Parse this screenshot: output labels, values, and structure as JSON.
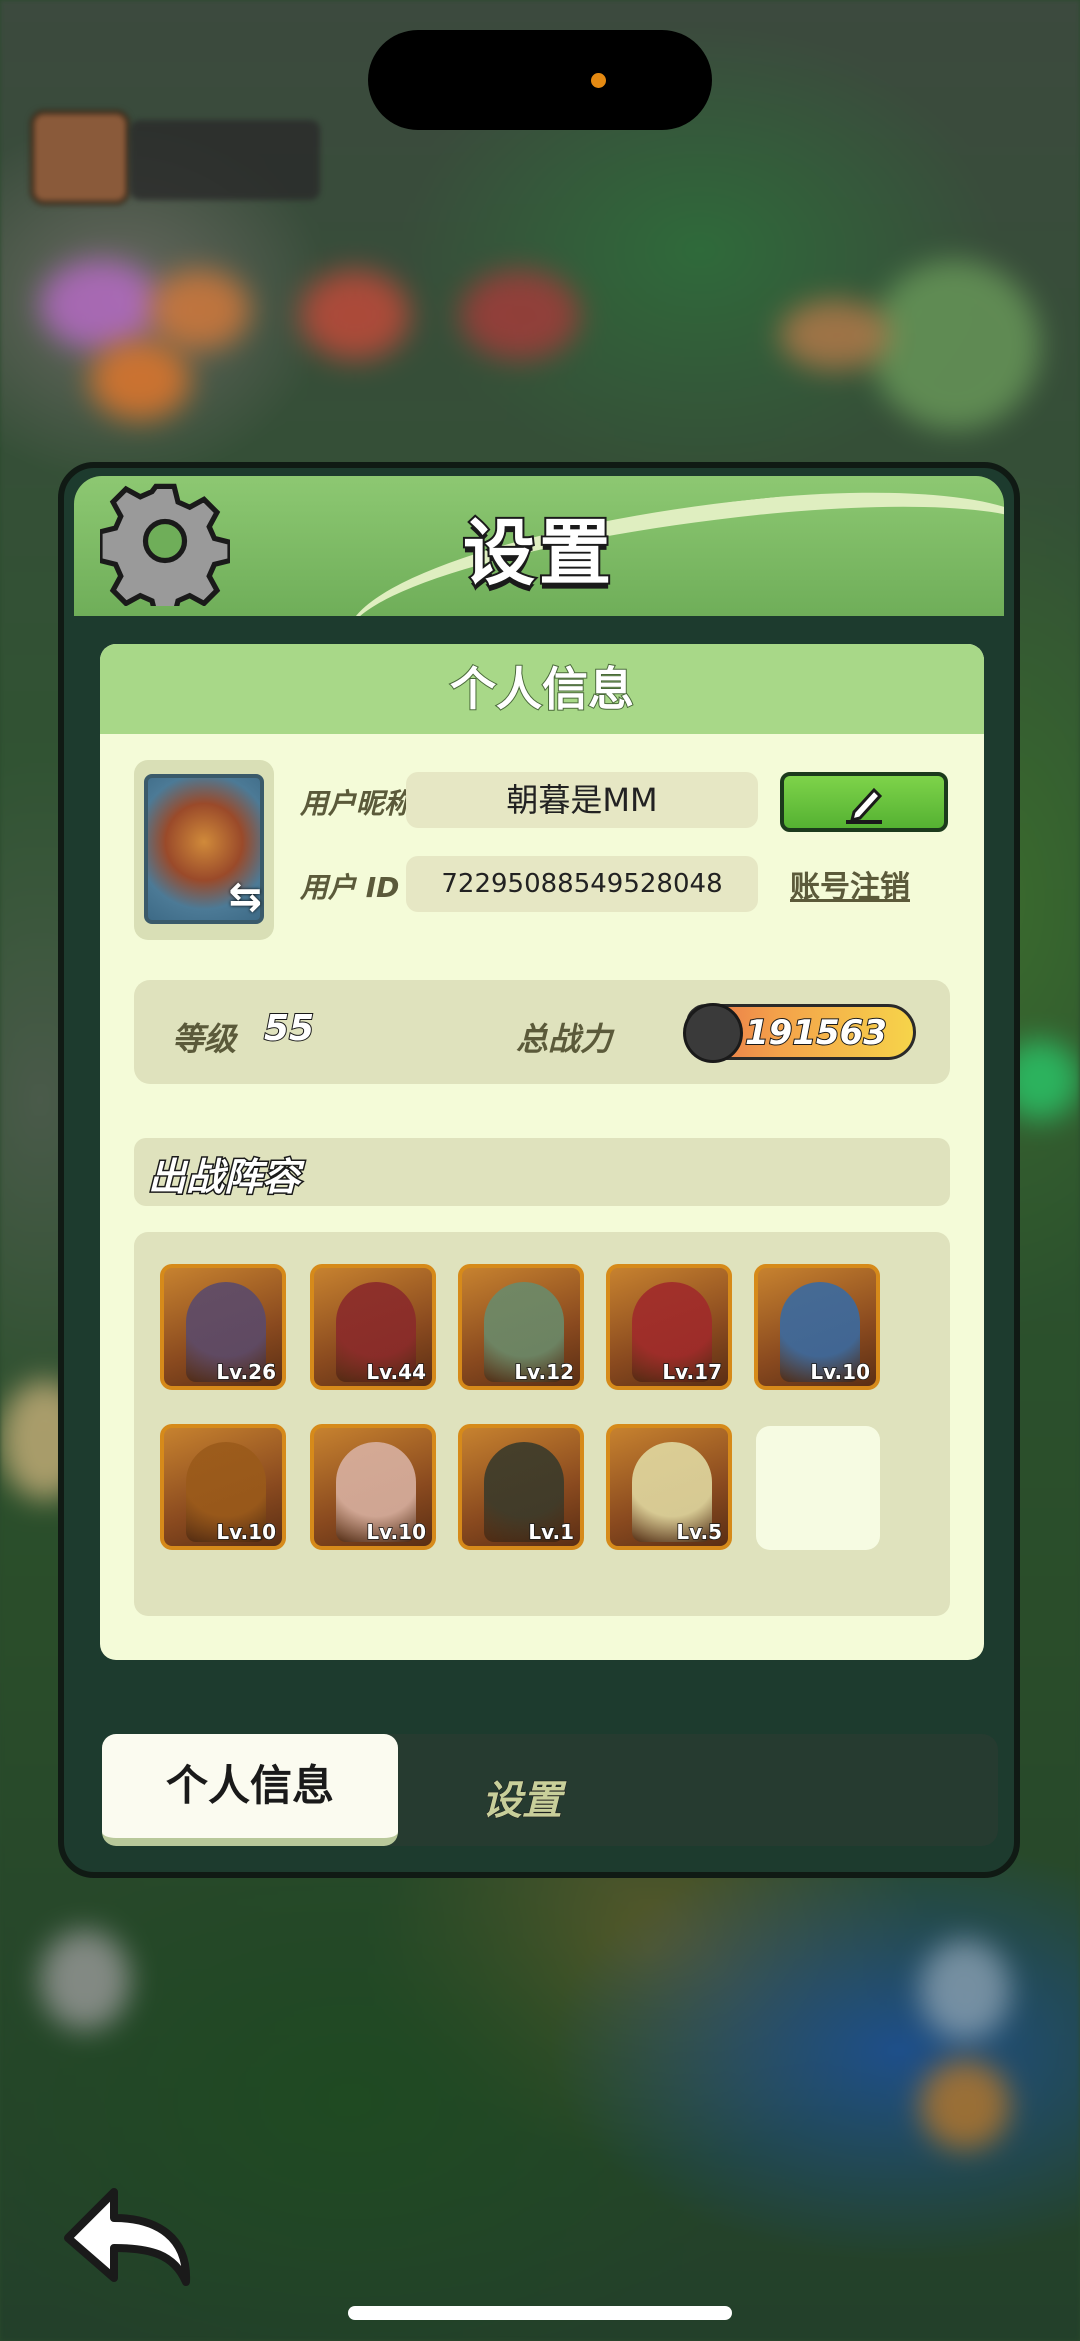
{
  "modal": {
    "title": "设置"
  },
  "profile": {
    "section_title": "个人信息",
    "nickname_label": "用户昵称",
    "nickname": "朝暮是MM",
    "id_label": "用户  ID",
    "user_id": "72295088549528048",
    "cancel_account_label": "账号注销",
    "level_label": "等级",
    "level": "55",
    "power_label": "总战力",
    "power": "191563"
  },
  "lineup": {
    "title": "出战阵容",
    "heroes": [
      {
        "level": "Lv.26",
        "color": "#5b4a6a"
      },
      {
        "level": "Lv.44",
        "color": "#8a2a2a"
      },
      {
        "level": "Lv.12",
        "color": "#6a8a6a"
      },
      {
        "level": "Lv.17",
        "color": "#a02a2a"
      },
      {
        "level": "Lv.10",
        "color": "#3a6aa0"
      },
      {
        "level": "Lv.10",
        "color": "#9a5a1a"
      },
      {
        "level": "Lv.10",
        "color": "#d8b0a0"
      },
      {
        "level": "Lv.1",
        "color": "#3a3a2a"
      },
      {
        "level": "Lv.5",
        "color": "#e0d8a0"
      }
    ]
  },
  "tabs": {
    "active": "个人信息",
    "inactive": "设置"
  },
  "colors": {
    "header_green": "#8dc872",
    "panel_cream": "#f4fbd8",
    "edit_button_green": "#55b232",
    "hero_border": "#d68a1a"
  }
}
